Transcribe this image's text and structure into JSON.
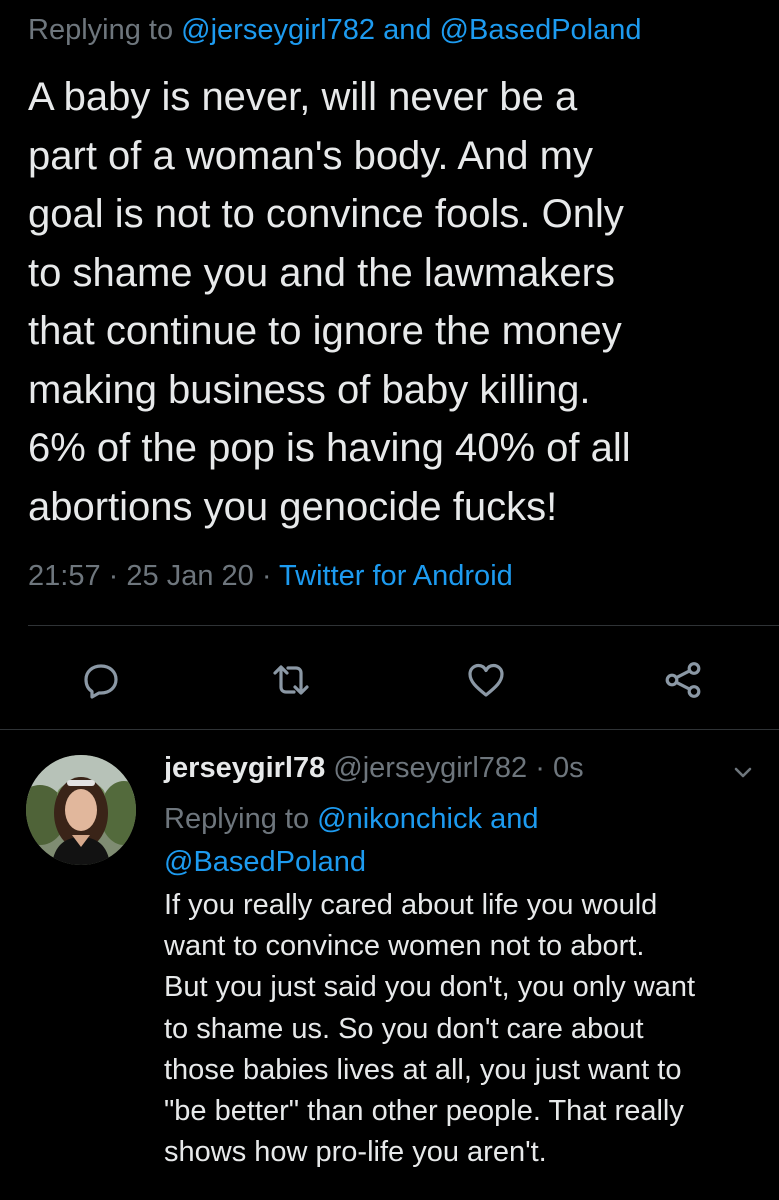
{
  "main_tweet": {
    "replying_prefix": "Replying to",
    "replying_handle_1": "@jerseygirl782",
    "replying_and": "and",
    "replying_handle_2": "@BasedPoland",
    "text_lines": [
      "A baby is never, will never be a",
      "part of a woman's body. And my",
      "goal is not to convince fools. Only",
      "to shame you and the lawmakers",
      "that continue to ignore the money",
      "making business of baby killing.",
      "6% of the pop is having 40% of all",
      "abortions you genocide fucks!"
    ],
    "time": "21:57",
    "sep1": "·",
    "date": "25 Jan 20",
    "sep2": "·",
    "source": "Twitter for Android"
  },
  "actions": {
    "icons": [
      "reply-icon",
      "retweet-icon",
      "like-icon",
      "share-icon"
    ],
    "color": "#8b98a5"
  },
  "reply_tweet": {
    "display_name": "jerseygirl78",
    "handle": "@jerseygirl782",
    "sep": "·",
    "time": "0s",
    "replying_prefix": "Replying to",
    "replying_handle_1": "@nikonchick",
    "replying_and": "and",
    "replying_handle_2": "@BasedPoland",
    "text_lines": [
      "If you really cared about life you would",
      "want to convince women not to abort.",
      "But you just said you don't, you only want",
      "to shame us. So you don't care about",
      "those babies lives at all, you just want to",
      "\"be better\" than other people. That really",
      "shows how pro-life you aren't."
    ]
  },
  "colors": {
    "background": "#000000",
    "text": "#e7e9ea",
    "muted": "#6e767d",
    "link": "#1d9bf0",
    "divider": "#2f3336"
  }
}
